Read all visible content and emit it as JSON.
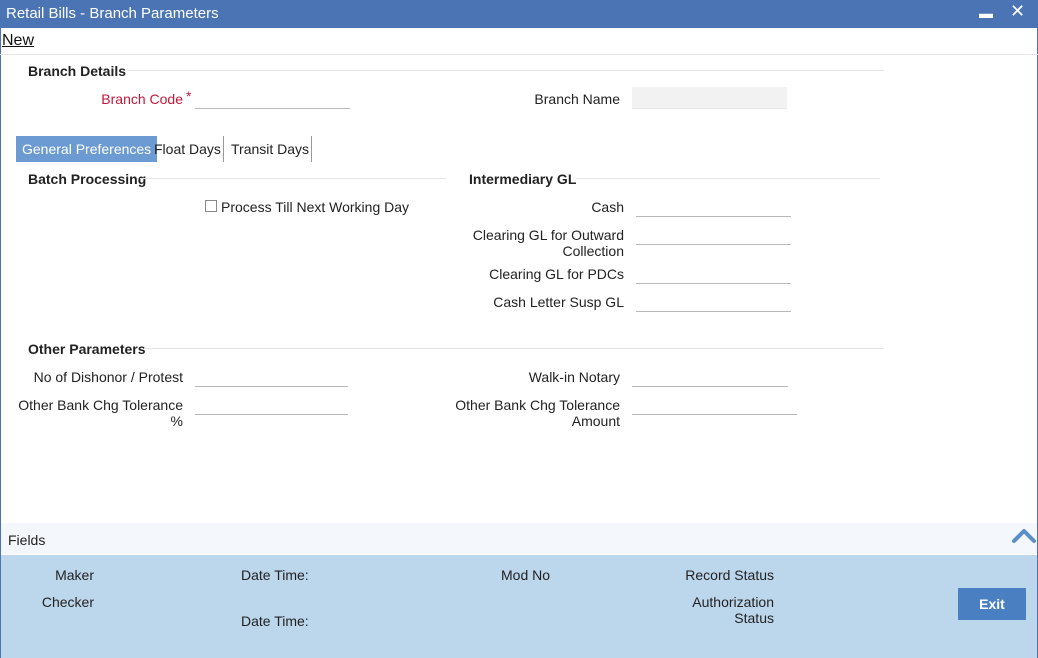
{
  "window": {
    "title": "Retail Bills - Branch Parameters",
    "minimize_glyph": "▬",
    "close_glyph": "✕"
  },
  "toolbar": {
    "new_label": "New"
  },
  "branch_details": {
    "title": "Branch Details",
    "branch_code_label": "Branch Code",
    "required_mark": "*",
    "branch_code_value": "",
    "branch_name_label": "Branch Name",
    "branch_name_value": ""
  },
  "tabs": [
    {
      "label": "General Preferences",
      "active": true
    },
    {
      "label": "Float Days",
      "active": false
    },
    {
      "label": "Transit Days",
      "active": false
    }
  ],
  "batch_processing": {
    "title": "Batch Processing",
    "process_till_next_label": "Process Till Next Working Day",
    "process_till_next_checked": false
  },
  "intermediary_gl": {
    "title": "Intermediary GL",
    "cash_label": "Cash",
    "clearing_outward_label_line1": "Clearing GL for Outward",
    "clearing_outward_label_line2": "Collection",
    "clearing_pdc_label": "Clearing GL for PDCs",
    "cash_letter_label": "Cash Letter Susp GL"
  },
  "other_parameters": {
    "title": "Other Parameters",
    "dishonor_label": "No of Dishonor / Protest",
    "bank_chg_tol_pct_label": "Other Bank Chg Tolerance %",
    "walkin_notary_label": "Walk-in Notary",
    "bank_chg_tol_amt_line1": "Other Bank Chg Tolerance",
    "bank_chg_tol_amt_line2": "Amount"
  },
  "fields_bar": {
    "label": "Fields"
  },
  "footer": {
    "maker_label": "Maker",
    "checker_label": "Checker",
    "date_time_label_1": "Date Time:",
    "date_time_label_2": "Date Time:",
    "mod_no_label": "Mod No",
    "record_status_label": "Record Status",
    "auth_status_line1": "Authorization",
    "auth_status_line2": "Status",
    "exit_label": "Exit"
  },
  "colors": {
    "title_bar": "#4a74b4",
    "active_tab": "#6b9bd2",
    "footer_bg": "#bcd6ec",
    "exit_button": "#4a7fc1",
    "required": "#c0183a"
  },
  "icons": {
    "minimize": "minimize-icon",
    "close": "close-icon",
    "collapse": "chevron-up-icon"
  }
}
